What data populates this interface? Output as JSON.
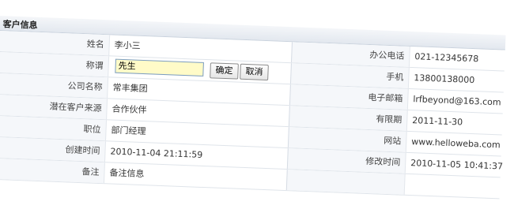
{
  "panel": {
    "title": "客户信息"
  },
  "rows": [
    {
      "l1": "姓名",
      "v1": "李小三",
      "l2": "办公电话",
      "v2": "021-12345678"
    },
    {
      "l1": "称谓",
      "v1": "先生",
      "l2": "手机",
      "v2": "13800138000"
    },
    {
      "l1": "公司名称",
      "v1": "常丰集团",
      "l2": "电子邮箱",
      "v2": "lrfbeyond@163.com"
    },
    {
      "l1": "潜在客户来源",
      "v1": "合作伙伴",
      "l2": "有限期",
      "v2": "2011-11-30"
    },
    {
      "l1": "职位",
      "v1": "部门经理",
      "l2": "网站",
      "v2": "www.helloweba.com"
    },
    {
      "l1": "创建时间",
      "v1": "2010-11-04 21:11:59",
      "l2": "修改时间",
      "v2": "2010-11-05 10:41:37"
    },
    {
      "l1": "备注",
      "v1": "备注信息",
      "l2": "",
      "v2": ""
    }
  ],
  "edit": {
    "confirm": "确定",
    "cancel": "取消"
  }
}
